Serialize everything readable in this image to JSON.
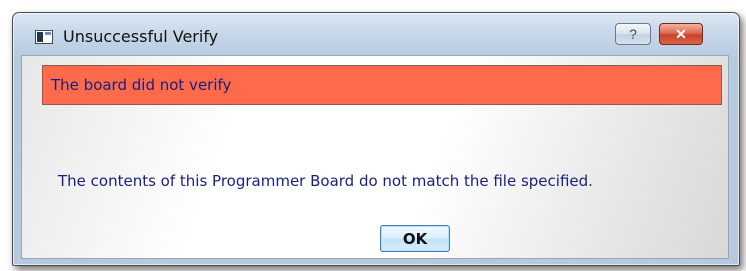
{
  "window": {
    "title": "Unsuccessful Verify",
    "icon": "app-window-icon",
    "controls": {
      "help_label": "?",
      "close_label": "✕"
    }
  },
  "dialog": {
    "error_banner": "The board did not verify",
    "message": "The contents of this Programmer Board do not match the file specified.",
    "ok_label": "OK"
  },
  "colors": {
    "banner": "#ff6a4a",
    "text": "#1a1f7a",
    "close_button": "#c8432b"
  }
}
